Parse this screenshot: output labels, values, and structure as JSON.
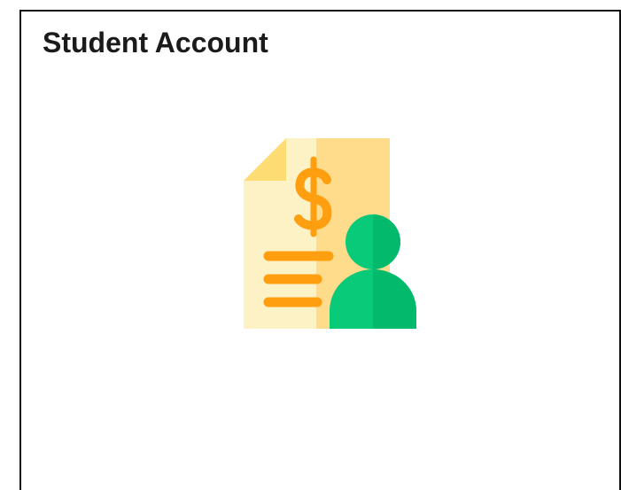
{
  "card": {
    "title": "Student Account",
    "icon": "student-billing-icon"
  },
  "colors": {
    "document_light": "#FCF2C6",
    "document_shade": "#FFDB8C",
    "fold": "#FDDD73",
    "dollar_and_lines": "#FF9F10",
    "person_light": "#08CA79",
    "person_shade": "#02B96C",
    "frame": "#111111",
    "title_text": "#1B1B1B"
  }
}
